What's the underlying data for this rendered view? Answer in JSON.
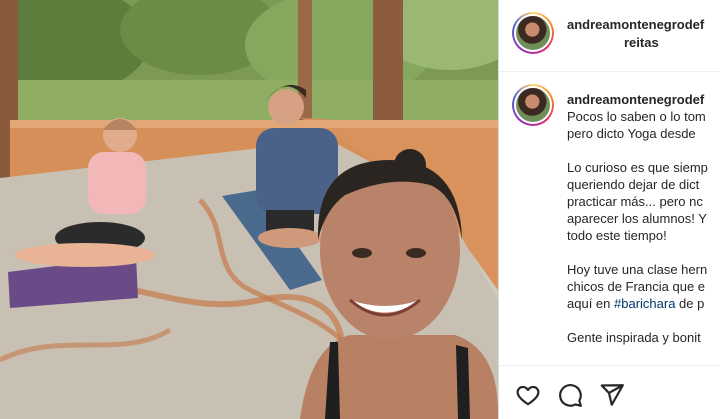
{
  "post_header": {
    "username": "andreamontenegrodef",
    "username_cont": "reitas"
  },
  "caption": {
    "username": "andreamontenegrodef",
    "lines": [
      "Pocos lo saben o lo tom",
      "pero dicto Yoga desde",
      "",
      "Lo curioso es que siemp",
      "queriendo dejar de dict",
      "practicar más... pero nc",
      "aparecer los alumnos! Y",
      "todo este tiempo!",
      "",
      "Hoy tuve una clase hern",
      "chicos de Francia que e",
      "aquí en ",
      "",
      "Gente inspirada y bonit"
    ],
    "hashtag": "#barichara",
    "hashtag_after": " de p"
  },
  "actions": {
    "like_icon": "heart-icon",
    "comment_icon": "comment-icon",
    "share_icon": "share-icon"
  },
  "colors": {
    "text": "#262626",
    "hashtag": "#00376b",
    "border": "#dbdbdb"
  }
}
